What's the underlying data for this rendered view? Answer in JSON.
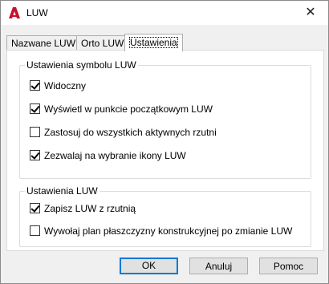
{
  "window": {
    "title": "LUW",
    "icon": "autocad-icon",
    "close_glyph": "✕"
  },
  "tabs": [
    {
      "label": "Nazwane LUW",
      "active": false
    },
    {
      "label": "Orto LUW",
      "active": false
    },
    {
      "label": "Ustawienia",
      "active": true
    }
  ],
  "groups": {
    "symbol": {
      "title": "Ustawienia symbolu LUW",
      "options": [
        {
          "label": "Widoczny",
          "checked": true
        },
        {
          "label": "Wyświetl w punkcie początkowym LUW",
          "checked": true
        },
        {
          "label": "Zastosuj do wszystkich aktywnych rzutni",
          "checked": false
        },
        {
          "label": "Zezwalaj na wybranie ikony LUW",
          "checked": true
        }
      ]
    },
    "luw": {
      "title": "Ustawienia LUW",
      "options": [
        {
          "label": "Zapisz LUW z rzutnią",
          "checked": true
        },
        {
          "label": "Wywołaj plan płaszczyzny konstrukcyjnej po zmianie LUW",
          "checked": false
        }
      ]
    }
  },
  "buttons": {
    "ok": "OK",
    "cancel": "Anuluj",
    "help": "Pomoc"
  },
  "colors": {
    "accent": "#0078d7",
    "icon_red": "#c8102e"
  }
}
